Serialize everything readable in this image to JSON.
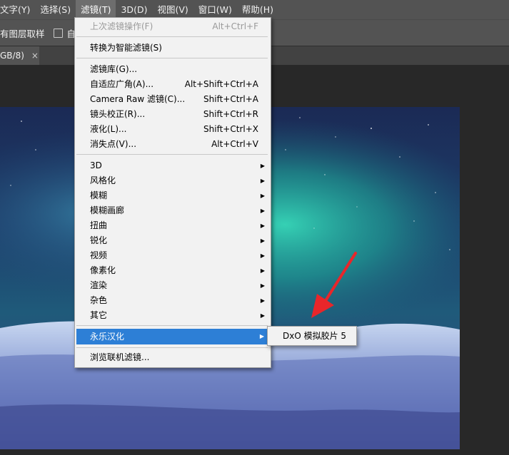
{
  "menubar": {
    "items": [
      {
        "label": "文字(Y)"
      },
      {
        "label": "选择(S)"
      },
      {
        "label": "滤镜(T)"
      },
      {
        "label": "3D(D)"
      },
      {
        "label": "视图(V)"
      },
      {
        "label": "窗口(W)"
      },
      {
        "label": "帮助(H)"
      }
    ],
    "active_index": 2
  },
  "optionsbar": {
    "sample_layers_label": "有图层取样",
    "auto_label": "自动"
  },
  "document_tab": {
    "title": "GB/8)",
    "close_glyph": "×"
  },
  "filter_menu": {
    "items": [
      {
        "label": "上次滤镜操作(F)",
        "shortcut": "Alt+Ctrl+F",
        "disabled": true
      },
      {
        "label": "转换为智能滤镜(S)",
        "shortcut": ""
      },
      {
        "label": "滤镜库(G)...",
        "shortcut": ""
      },
      {
        "label": "自适应广角(A)...",
        "shortcut": "Alt+Shift+Ctrl+A"
      },
      {
        "label": "Camera Raw 滤镜(C)...",
        "shortcut": "Shift+Ctrl+A"
      },
      {
        "label": "镜头校正(R)...",
        "shortcut": "Shift+Ctrl+R"
      },
      {
        "label": "液化(L)...",
        "shortcut": "Shift+Ctrl+X"
      },
      {
        "label": "消失点(V)...",
        "shortcut": "Alt+Ctrl+V"
      },
      {
        "label": "3D",
        "submenu": true
      },
      {
        "label": "风格化",
        "submenu": true
      },
      {
        "label": "模糊",
        "submenu": true
      },
      {
        "label": "模糊画廊",
        "submenu": true
      },
      {
        "label": "扭曲",
        "submenu": true
      },
      {
        "label": "锐化",
        "submenu": true
      },
      {
        "label": "视频",
        "submenu": true
      },
      {
        "label": "像素化",
        "submenu": true
      },
      {
        "label": "渲染",
        "submenu": true
      },
      {
        "label": "杂色",
        "submenu": true
      },
      {
        "label": "其它",
        "submenu": true
      },
      {
        "label": "永乐汉化",
        "submenu": true,
        "highlighted": true
      },
      {
        "label": "浏览联机滤镜..."
      }
    ],
    "arrow_glyph": "▶"
  },
  "submenu": {
    "items": [
      {
        "label": "DxO 模拟胶片 5"
      }
    ]
  },
  "colors": {
    "menubar_bg": "#535353",
    "menu_bg": "#f2f2f2",
    "highlight": "#2d7fd6",
    "annotation_arrow": "#e8262a"
  },
  "icons": [
    "close-icon",
    "submenu-arrow-icon",
    "annotation-arrow-icon",
    "checkbox"
  ]
}
